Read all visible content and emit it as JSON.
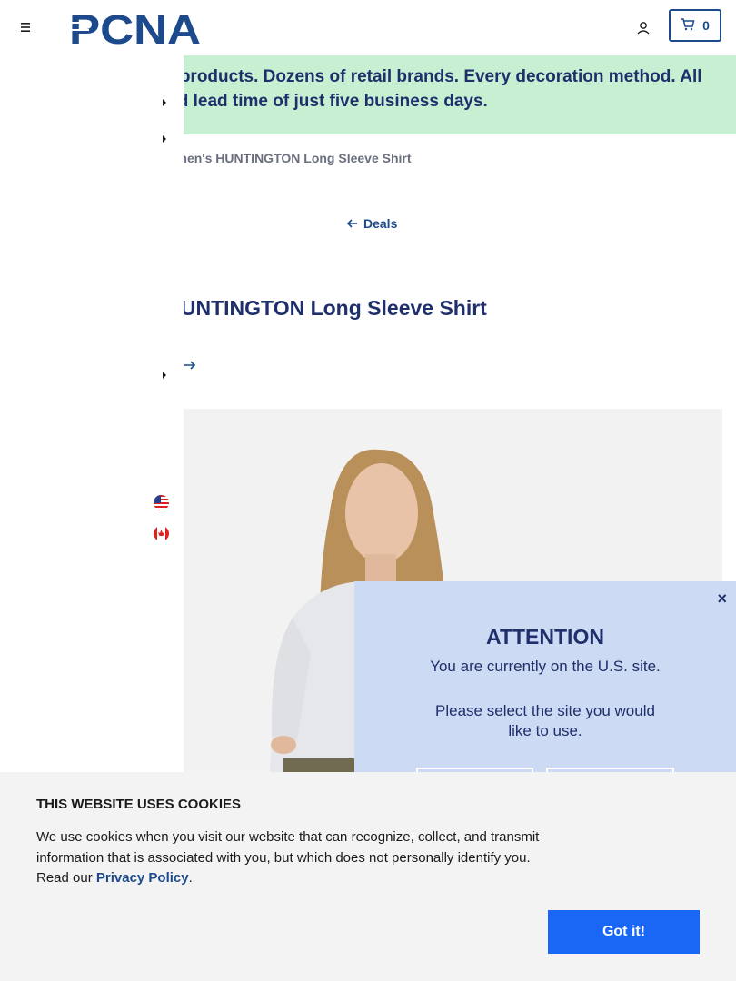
{
  "header": {
    "logo_text": "PCNA",
    "cart_count": "0"
  },
  "promo": {
    "text": "Thousands of products. Dozens of retail brands. Every decoration method. All with a standard lead time of just five business days."
  },
  "breadcrumb": {
    "current": "Women's HUNTINGTON Long Sleeve Shirt"
  },
  "back_link": {
    "label": "Deals"
  },
  "product": {
    "title": "Women's HUNTINGTON Long Sleeve Shirt"
  },
  "modal": {
    "title": "ATTENTION",
    "line1": "You are currently on the U.S. site.",
    "line2": "Please select the site you would like to use.",
    "close": "×"
  },
  "cookie": {
    "title": "THIS WEBSITE USES COOKIES",
    "text_before_link": "We use cookies when you visit our website that can recognize, collect, and transmit information that is associated with you, but which does not personally identify you. Read our ",
    "link_label": "Privacy Policy",
    "text_after_link": ".",
    "button_label": "Got it!"
  },
  "colors": {
    "brand_blue": "#1c4a8c",
    "navy_text": "#1f2f6b",
    "promo_bg": "#c7f0d3",
    "modal_bg": "#ccdaf3",
    "cookie_button": "#1a66f5"
  }
}
